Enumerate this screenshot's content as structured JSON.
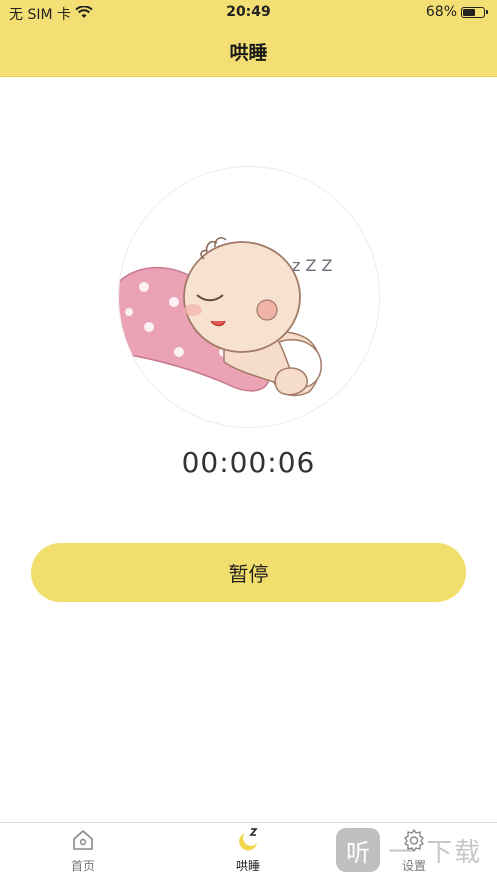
{
  "status_bar": {
    "carrier": "无 SIM 卡",
    "time": "20:49",
    "battery_percent": "68%",
    "battery_level": 0.68
  },
  "nav": {
    "title": "哄睡"
  },
  "illustration": {
    "snore_text": "z Z Z"
  },
  "timer": {
    "elapsed": "00:00:06"
  },
  "controls": {
    "pause_label": "暂停"
  },
  "tabs": [
    {
      "label": "首页",
      "icon": "home-icon",
      "active": false
    },
    {
      "label": "哄睡",
      "icon": "moon-sleep-icon",
      "active": true
    },
    {
      "label": "设置",
      "icon": "settings-icon",
      "active": false
    }
  ],
  "watermark": {
    "text": "一 下载",
    "badge_glyph": "听"
  },
  "colors": {
    "accent": "#f4df74",
    "button": "#f2de6c"
  }
}
